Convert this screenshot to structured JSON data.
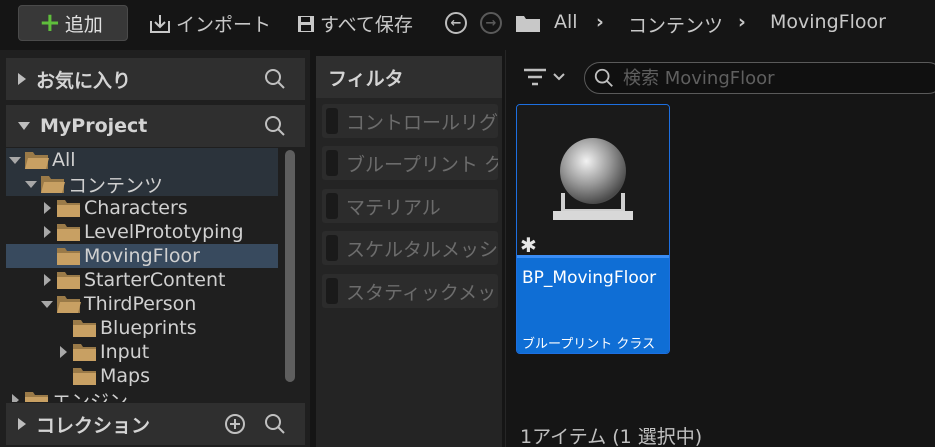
{
  "toolbar": {
    "add_label": "追加",
    "import_label": "インポート",
    "save_all_label": "すべて保存"
  },
  "breadcrumb": [
    "All",
    "コンテンツ",
    "MovingFloor"
  ],
  "left_panel": {
    "favorites_title": "お気に入り",
    "project_title": "MyProject",
    "collections_title": "コレクション",
    "tree": [
      {
        "label": "All",
        "level": 0,
        "expanded": true
      },
      {
        "label": "コンテンツ",
        "level": 1,
        "expanded": true
      },
      {
        "label": "Characters",
        "level": 2,
        "expanded": false
      },
      {
        "label": "LevelPrototyping",
        "level": 2,
        "expanded": false
      },
      {
        "label": "MovingFloor",
        "level": 2,
        "selected": true
      },
      {
        "label": "StarterContent",
        "level": 2,
        "expanded": false
      },
      {
        "label": "ThirdPerson",
        "level": 2,
        "expanded": true
      },
      {
        "label": "Blueprints",
        "level": 3
      },
      {
        "label": "Input",
        "level": 3,
        "expanded": false
      },
      {
        "label": "Maps",
        "level": 3
      },
      {
        "label": "エンジン",
        "level": 0,
        "expanded": false
      }
    ]
  },
  "filter_panel": {
    "title": "フィルタ",
    "items": [
      "コントロールリグ",
      "ブループリント クラス",
      "マテリアル",
      "スケルタルメッシュ",
      "スタティックメッシュ"
    ]
  },
  "content": {
    "search_placeholder": "検索 MovingFloor",
    "asset": {
      "name": "BP_MovingFloor",
      "type": "ブループリント クラス"
    },
    "status": "1アイテム (1 選択中)"
  },
  "colors": {
    "accent_blue": "#0f6ed5",
    "add_green": "#5fbe3c",
    "folder": "#c8a063"
  }
}
